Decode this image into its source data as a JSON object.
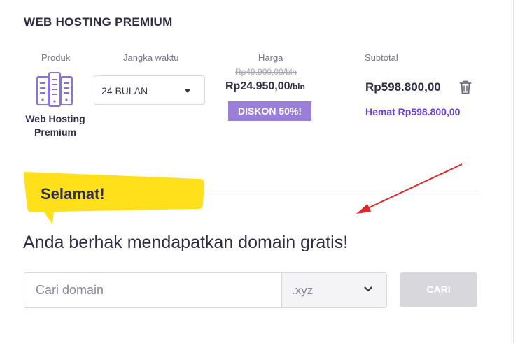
{
  "section": {
    "title": "WEB HOSTING PREMIUM"
  },
  "columns": {
    "product": "Produk",
    "period": "Jangka waktu",
    "price": "Harga",
    "subtotal": "Subtotal"
  },
  "item": {
    "name": "Web Hosting Premium",
    "period_value": "24 BULAN",
    "old_price": "Rp49.900,00/bln",
    "new_price": "Rp24.950,00",
    "price_unit": "/bln",
    "discount": "DISKON 50%!",
    "subtotal": "Rp598.800,00",
    "savings": "Hemat Rp598.800,00"
  },
  "banner": {
    "text": "Selamat!"
  },
  "promo": {
    "text": "Anda berhak mendapatkan domain gratis!"
  },
  "domain_search": {
    "placeholder": "Cari domain",
    "tld": ".xyz",
    "button": "CARI"
  },
  "colors": {
    "accent": "#673de6",
    "badge": "#9a7fd6",
    "banner": "#ffe01b",
    "arrow": "#e0282b",
    "disabled": "#d8d8dc"
  },
  "icons": {
    "product": "server-icon",
    "delete": "trash-icon",
    "dropdown": "chevron-down-icon"
  }
}
